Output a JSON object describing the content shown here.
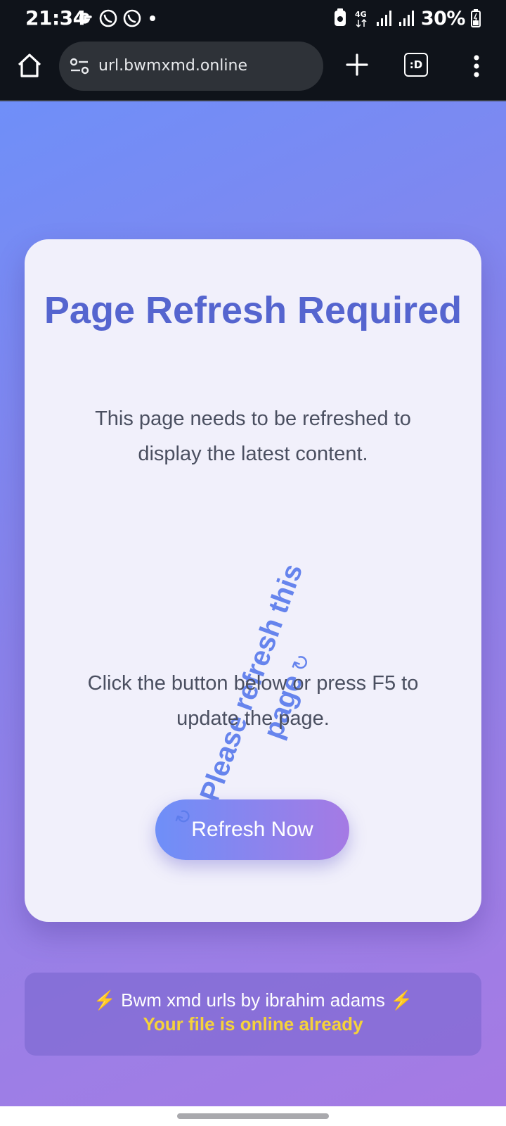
{
  "status_bar": {
    "time": "21:34",
    "left_icons": [
      "google-g-icon",
      "whatsapp-icon",
      "whatsapp-icon",
      "dot-icon"
    ],
    "network": "4G",
    "battery_percent": "30%"
  },
  "browser": {
    "url": "url.bwmxmd.online",
    "tab_switcher_label": ":D"
  },
  "card": {
    "title": "Page Refresh Required",
    "text1": "This page needs to be refreshed to display the latest content.",
    "rotated_note": "Please refresh this page",
    "text2": "Click the button below or press F5 to update the page.",
    "button_label": "Refresh Now"
  },
  "footer": {
    "line1": "Bwm xmd urls by ibrahim adams",
    "line2": "Your file is online already"
  },
  "colors": {
    "title": "#5565cf",
    "accent_start": "#6e8ff8",
    "accent_end": "#a57ae4",
    "footer_highlight": "#f5d23a"
  }
}
